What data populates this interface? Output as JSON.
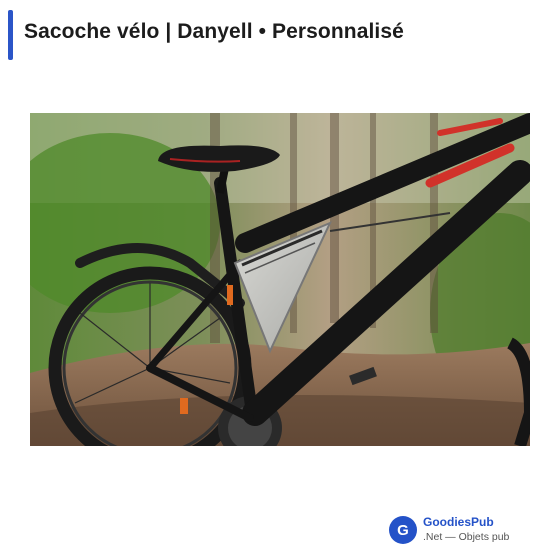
{
  "page": {
    "title": "Sacoche vélo | Danyell • Personnalisé"
  },
  "image": {
    "alt": "Sacoche vélo triangulaire grise montée sur le cadre d'un vélo noir en forêt"
  },
  "brand": {
    "logo_letter": "G",
    "name": "GoodiesPub",
    "tagline": ".Net — Objets pub"
  },
  "colors": {
    "accent": "#2b55c8",
    "title_text": "#1c1c1c"
  }
}
